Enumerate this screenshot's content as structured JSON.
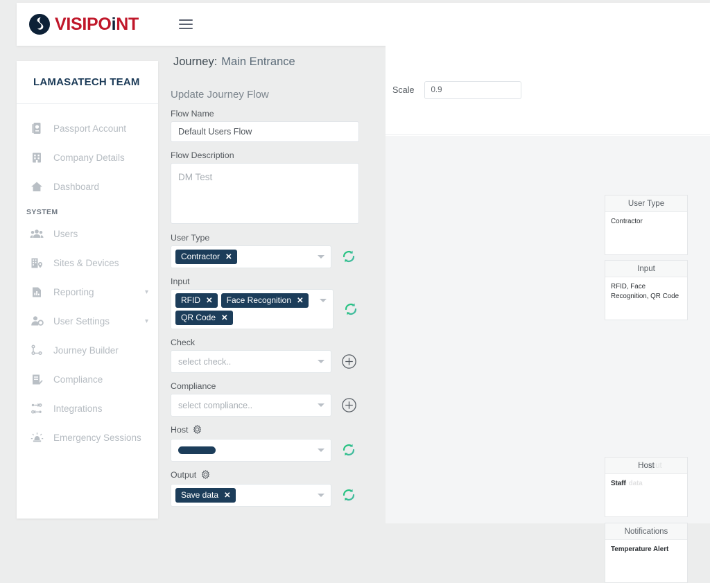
{
  "brand": {
    "name_part1": "VISIPO",
    "name_i": "i",
    "name_part2": "NT",
    "logo_icon": "visipoint-circle-logo",
    "accent_red": "#c0172a",
    "accent_navy": "#0d2137"
  },
  "topbar": {
    "menu_icon": "hamburger-menu-icon"
  },
  "sidebar": {
    "team_name": "LAMASATECH TEAM",
    "items": [
      {
        "label": "Passport Account",
        "icon": "passport-icon",
        "expandable": false
      },
      {
        "label": "Company Details",
        "icon": "building-icon",
        "expandable": false
      },
      {
        "label": "Dashboard",
        "icon": "home-icon",
        "expandable": false
      }
    ],
    "section_label": "SYSTEM",
    "system_items": [
      {
        "label": "Users",
        "icon": "users-icon",
        "expandable": false
      },
      {
        "label": "Sites & Devices",
        "icon": "sites-devices-icon",
        "expandable": false
      },
      {
        "label": "Reporting",
        "icon": "reporting-chart-icon",
        "expandable": true
      },
      {
        "label": "User Settings",
        "icon": "user-settings-icon",
        "expandable": true
      },
      {
        "label": "Journey Builder",
        "icon": "journey-builder-icon",
        "expandable": false
      },
      {
        "label": "Compliance",
        "icon": "compliance-checklist-icon",
        "expandable": false
      },
      {
        "label": "Integrations",
        "icon": "integrations-icon",
        "expandable": false
      },
      {
        "label": "Emergency Sessions",
        "icon": "emergency-alarm-icon",
        "expandable": false
      }
    ],
    "chevron_icon": "chevron-down-icon"
  },
  "main": {
    "journey_label": "Journey:",
    "journey_value": "Main Entrance",
    "form_title": "Update Journey Flow",
    "fields": {
      "flow_name": {
        "label": "Flow Name",
        "value": "Default Users Flow"
      },
      "flow_description": {
        "label": "Flow Description",
        "placeholder": "DM Test"
      },
      "user_type": {
        "label": "User Type",
        "chips": [
          "Contractor"
        ],
        "action_icon": "sync-refresh-icon"
      },
      "input": {
        "label": "Input",
        "chips": [
          "RFID",
          "Face Recognition",
          "QR Code"
        ],
        "action_icon": "sync-refresh-icon"
      },
      "check": {
        "label": "Check",
        "placeholder": "select check..",
        "action_icon": "plus-circle-icon"
      },
      "compliance": {
        "label": "Compliance",
        "placeholder": "select compliance..",
        "action_icon": "plus-circle-icon"
      },
      "host": {
        "label": "Host",
        "label_icon": "gear-icon",
        "value_redacted": true,
        "action_icon": "sync-refresh-icon"
      },
      "output": {
        "label": "Output",
        "label_icon": "gear-icon",
        "chips": [
          "Save data"
        ],
        "action_icon": "sync-refresh-icon"
      }
    },
    "chip_close_icon": "close-x-icon",
    "dropdown_icon": "caret-down-icon"
  },
  "canvas": {
    "scale_label": "Scale",
    "scale_value": "0.9",
    "nodes": [
      {
        "title": "User Type",
        "body": "Contractor",
        "bold": false
      },
      {
        "title": "Input",
        "body": "RFID, Face Recognition, QR Code",
        "bold": false
      },
      {
        "title": "Host",
        "title_ghost": "Output",
        "body": "Staff",
        "body_ghost": "Save data",
        "bold": true
      },
      {
        "title": "Notifications",
        "body": "Temperature Alert",
        "bold": true
      }
    ]
  }
}
